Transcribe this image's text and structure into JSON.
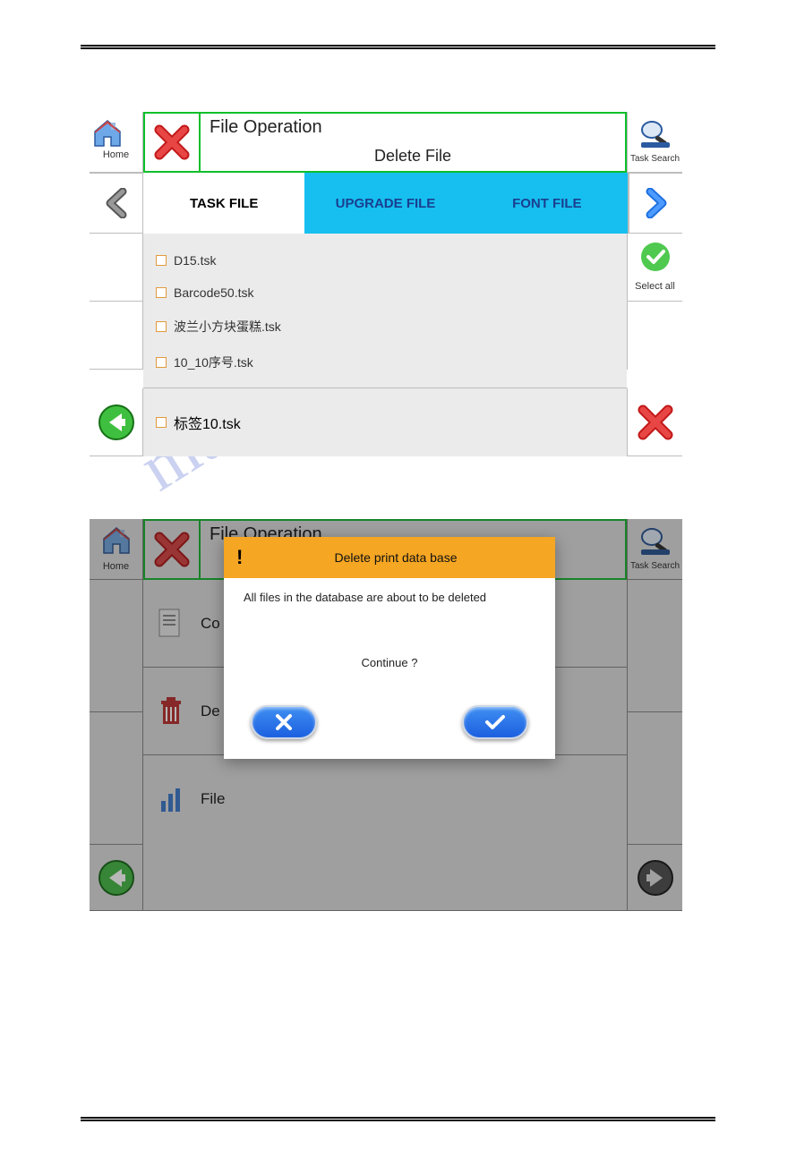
{
  "watermark": "manualshive.com",
  "screen1": {
    "home_label": "Home",
    "title": "File Operation",
    "subtitle": "Delete File",
    "search_label": "Task Search",
    "tabs": {
      "task": "TASK FILE",
      "upgrade": "UPGRADE FILE",
      "font": "FONT FILE"
    },
    "files": [
      "D15.tsk",
      "Barcode50.tsk",
      "波兰小方块蛋糕.tsk",
      "10_10序号.tsk",
      "标签10.tsk"
    ],
    "select_all_label": "Select all"
  },
  "screen2": {
    "home_label": "Home",
    "title": "File Operation",
    "search_label": "Task Search",
    "menu": {
      "copy": "Co",
      "delete": "De",
      "file": "File"
    },
    "dialog": {
      "heading": "Delete print data base",
      "message": "All files in the database are about to be deleted",
      "prompt": "Continue ?"
    }
  }
}
